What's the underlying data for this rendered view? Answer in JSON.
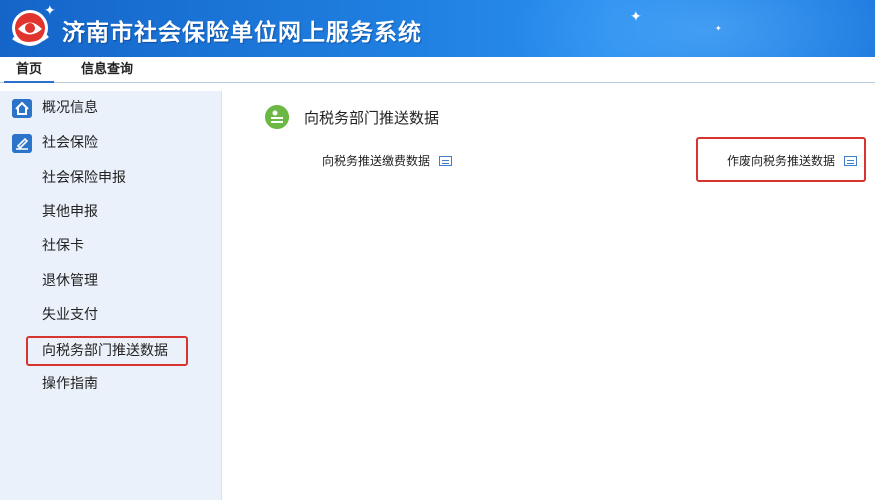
{
  "header": {
    "title": "济南市社会保险单位网上服务系统"
  },
  "tabs": [
    {
      "label": "首页",
      "active": true
    },
    {
      "label": "信息查询",
      "active": false
    }
  ],
  "sidebar": {
    "items": [
      {
        "label": "概况信息",
        "icon": "home-icon"
      },
      {
        "label": "社会保险",
        "icon": "edit-icon"
      },
      {
        "label": "社会保险申报"
      },
      {
        "label": "其他申报"
      },
      {
        "label": "社保卡"
      },
      {
        "label": "退休管理"
      },
      {
        "label": "失业支付"
      },
      {
        "label": "向税务部门推送数据",
        "selected": true
      },
      {
        "label": "操作指南"
      }
    ]
  },
  "main": {
    "section_title": "向税务部门推送数据",
    "links": [
      {
        "label": "向税务推送缴费数据"
      },
      {
        "label": "作废向税务推送数据"
      }
    ]
  },
  "colors": {
    "header_blue": "#1f7fe0",
    "highlight_red": "#d8342f",
    "section_icon_green": "#6cb845",
    "sidebar_bg": "#eaf1fa"
  }
}
